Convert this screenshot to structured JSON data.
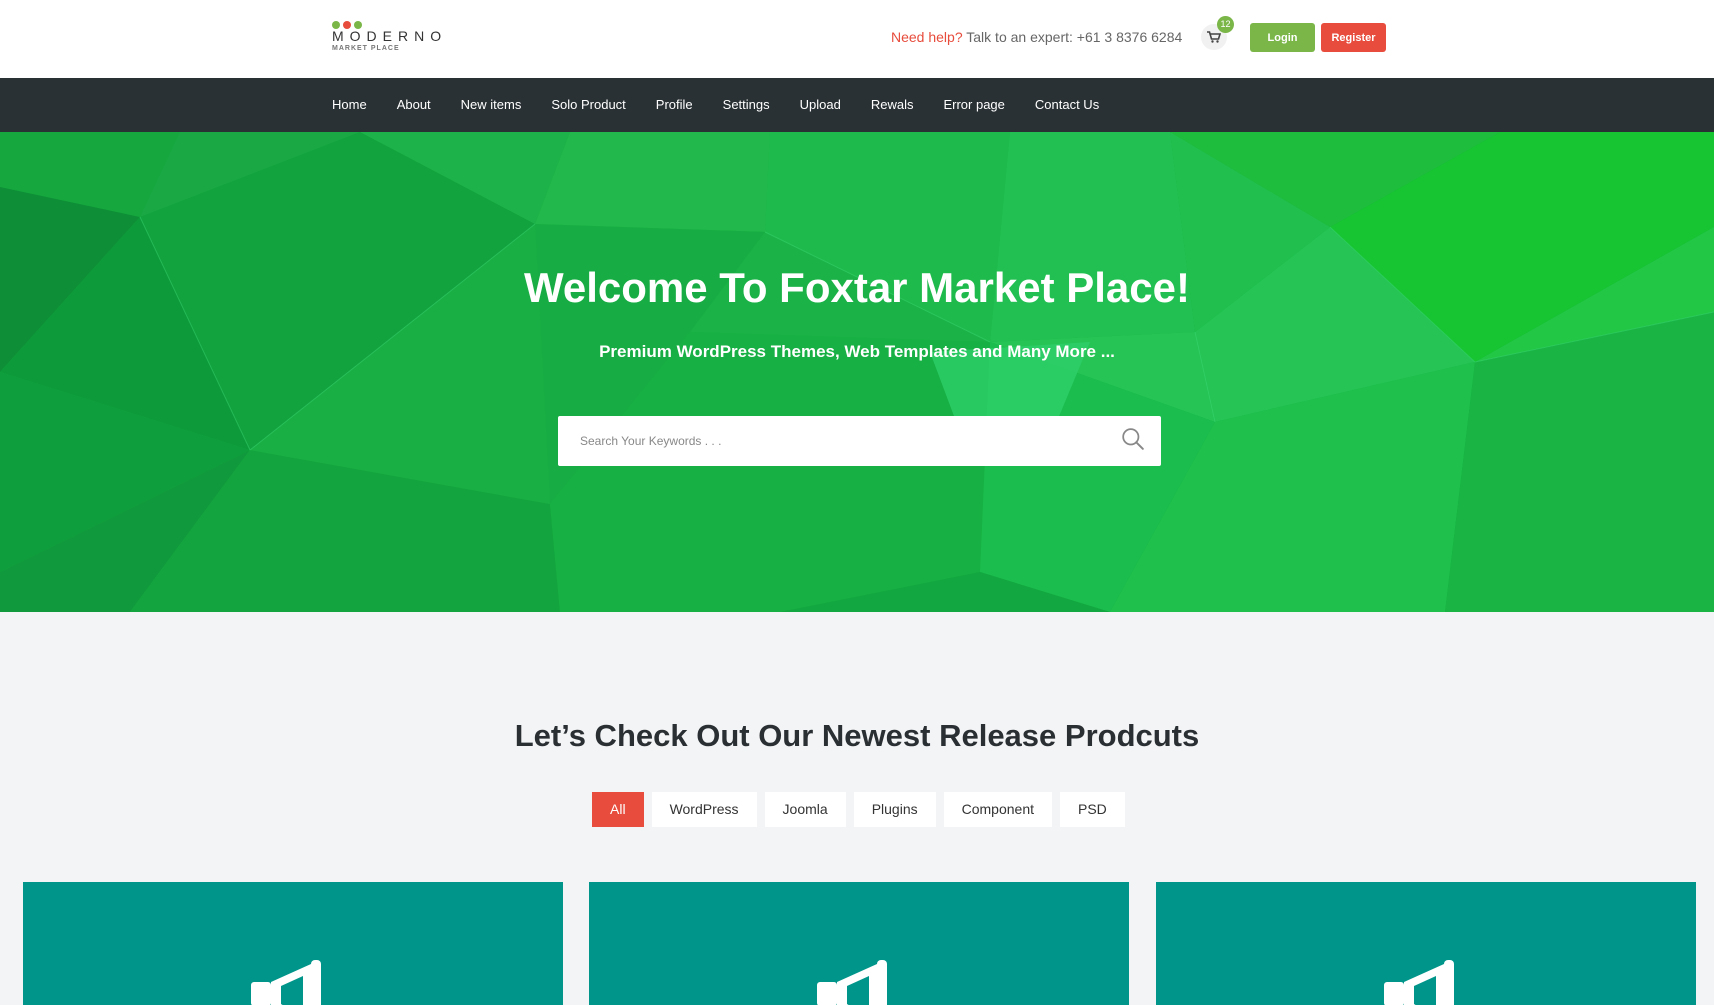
{
  "brand": {
    "name": "MODERNO",
    "tagline": "MARKET PLACE",
    "dot_colors": [
      "#7ab648",
      "#e74c3c",
      "#7ab648"
    ]
  },
  "header": {
    "help_highlight": "Need help?",
    "help_text": "Talk to an expert: +61 3 8376 6284",
    "cart_icon": "cart-icon",
    "cart_count": "12",
    "login_label": "Login",
    "register_label": "Register"
  },
  "nav": {
    "items": [
      "Home",
      "About",
      "New items",
      "Solo Product",
      "Profile",
      "Settings",
      "Upload",
      "Rewals",
      "Error page",
      "Contact Us"
    ]
  },
  "hero": {
    "title": "Welcome To Foxtar Market Place!",
    "subtitle": "Premium WordPress Themes, Web Templates and Many More ...",
    "search_placeholder": "Search Your Keywords . . .",
    "search_icon": "search-icon"
  },
  "products": {
    "heading": "Let’s Check Out Our Newest Release Prodcuts",
    "filters": [
      "All",
      "WordPress",
      "Joomla",
      "Plugins",
      "Component",
      "PSD"
    ],
    "active_filter": "All",
    "card_icon": "megaphone-icon",
    "card_count": 3
  },
  "colors": {
    "accent_green": "#7ab648",
    "accent_red": "#e74c3c",
    "nav_bg": "#2a3135",
    "hero_green": "#14b13c",
    "card_teal": "#00958a",
    "page_bg": "#f3f4f5"
  }
}
